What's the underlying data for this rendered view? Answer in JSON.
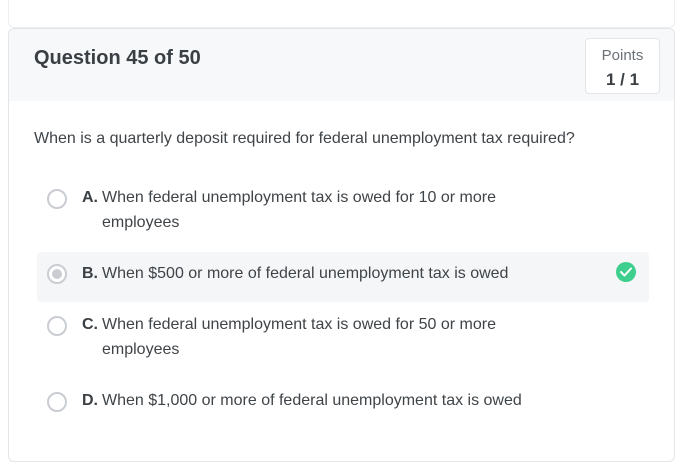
{
  "question": {
    "title": "Question 45 of 50",
    "points_label": "Points",
    "points_value": "1 / 1",
    "text": "When is a quarterly deposit required for federal unemployment tax required?"
  },
  "options": [
    {
      "letter": "A.",
      "text": "When federal unemployment tax is owed for 10 or more employees",
      "selected": false,
      "correct": false
    },
    {
      "letter": "B.",
      "text": "When $500 or more of federal unemployment tax is owed",
      "selected": true,
      "correct": true
    },
    {
      "letter": "C.",
      "text": "When federal unemployment tax is owed for 50 or more employees",
      "selected": false,
      "correct": false
    },
    {
      "letter": "D.",
      "text": "When $1,000 or more of federal unemployment tax is owed",
      "selected": false,
      "correct": false
    }
  ],
  "colors": {
    "correct": "#3ecf8e",
    "header_bg": "#f7f8fa",
    "selected_bg": "#f5f6f8"
  },
  "icons": {
    "correct": "check-circle-icon",
    "radio": "radio-button-icon"
  }
}
